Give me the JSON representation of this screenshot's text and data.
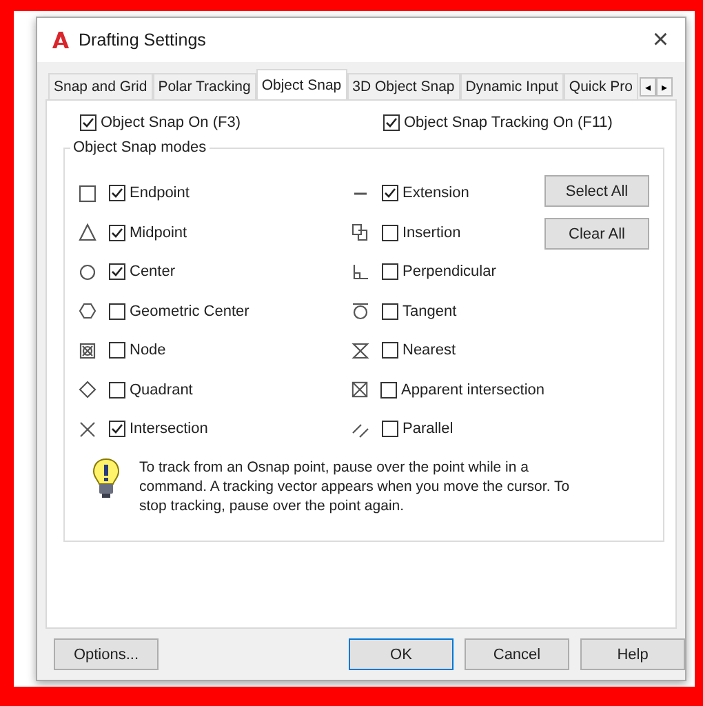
{
  "window": {
    "title": "Drafting Settings",
    "close": "×"
  },
  "tabs": [
    {
      "label": "Snap and Grid",
      "selected": false
    },
    {
      "label": "Polar Tracking",
      "selected": false
    },
    {
      "label": "Object Snap",
      "selected": true
    },
    {
      "label": "3D Object Snap",
      "selected": false
    },
    {
      "label": "Dynamic Input",
      "selected": false
    },
    {
      "label": "Quick Pro",
      "selected": false
    }
  ],
  "tab_scroll": [
    "◂",
    "▸"
  ],
  "toggles": [
    {
      "label": "Object Snap On (F3)",
      "checked": true
    },
    {
      "label": "Object Snap Tracking On (F11)",
      "checked": true
    }
  ],
  "modes_group": {
    "title": "Object Snap modes",
    "left": [
      {
        "label": "Endpoint",
        "checked": true
      },
      {
        "label": "Midpoint",
        "checked": true
      },
      {
        "label": "Center",
        "checked": true
      },
      {
        "label": "Geometric Center",
        "checked": false
      },
      {
        "label": "Node",
        "checked": false
      },
      {
        "label": "Quadrant",
        "checked": false
      },
      {
        "label": "Intersection",
        "checked": true
      }
    ],
    "right": [
      {
        "label": "Extension",
        "checked": true
      },
      {
        "label": "Insertion",
        "checked": false
      },
      {
        "label": "Perpendicular",
        "checked": false
      },
      {
        "label": "Tangent",
        "checked": false
      },
      {
        "label": "Nearest",
        "checked": false
      },
      {
        "label": "Apparent intersection",
        "checked": false
      },
      {
        "label": "Parallel",
        "checked": false
      }
    ],
    "buttons": [
      "Select All",
      "Clear All"
    ]
  },
  "tip": "To track from an Osnap point, pause over the point while in a command.  A tracking vector appears when you move the cursor.  To stop tracking, pause over the point again.",
  "footer": {
    "options": "Options...",
    "buttons": [
      {
        "label": "OK",
        "default": true
      },
      {
        "label": "Cancel",
        "default": false
      },
      {
        "label": "Help",
        "default": false
      }
    ]
  }
}
